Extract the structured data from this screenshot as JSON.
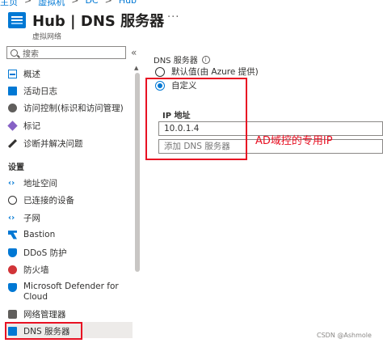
{
  "breadcrumb": [
    "主页",
    "虚拟机",
    "DC",
    "Hub"
  ],
  "header": {
    "title": "Hub | DNS 服务器",
    "subtitle": "虚拟网络",
    "favorite_icon": "star-icon",
    "more": "···"
  },
  "sidebar": {
    "search_placeholder": "搜索",
    "collapse": "«",
    "items_top": [
      {
        "label": "概述",
        "icon": "overview-icon"
      },
      {
        "label": "活动日志",
        "icon": "activity-log-icon"
      },
      {
        "label": "访问控制(标识和访问管理)",
        "icon": "iam-icon"
      },
      {
        "label": "标记",
        "icon": "tag-icon"
      },
      {
        "label": "诊断并解决问题",
        "icon": "diagnose-icon"
      }
    ],
    "section_settings": "设置",
    "items_settings": [
      {
        "label": "地址空间",
        "icon": "address-space-icon"
      },
      {
        "label": "已连接的设备",
        "icon": "connected-devices-icon"
      },
      {
        "label": "子网",
        "icon": "subnet-icon"
      },
      {
        "label": "Bastion",
        "icon": "bastion-icon"
      },
      {
        "label": "DDoS 防护",
        "icon": "ddos-icon"
      },
      {
        "label": "防火墙",
        "icon": "firewall-icon"
      },
      {
        "label": "Microsoft Defender for",
        "label2": "Cloud",
        "icon": "defender-icon"
      },
      {
        "label": "网络管理器",
        "icon": "network-manager-icon"
      },
      {
        "label": "DNS 服务器",
        "icon": "dns-server-icon",
        "active": true
      }
    ]
  },
  "main": {
    "dns_label": "DNS 服务器",
    "info": "i",
    "options": [
      {
        "label": "默认值(由 Azure 提供)",
        "checked": false
      },
      {
        "label": "自定义",
        "checked": true
      }
    ],
    "ip_header": "IP 地址",
    "ip_value": "10.0.1.4",
    "add_placeholder": "添加 DNS 服务器"
  },
  "annotation": "AD域控的专用IP",
  "watermark": "CSDN @Ashmole",
  "colors": {
    "accent": "#0078d4",
    "highlight": "#e81123"
  }
}
